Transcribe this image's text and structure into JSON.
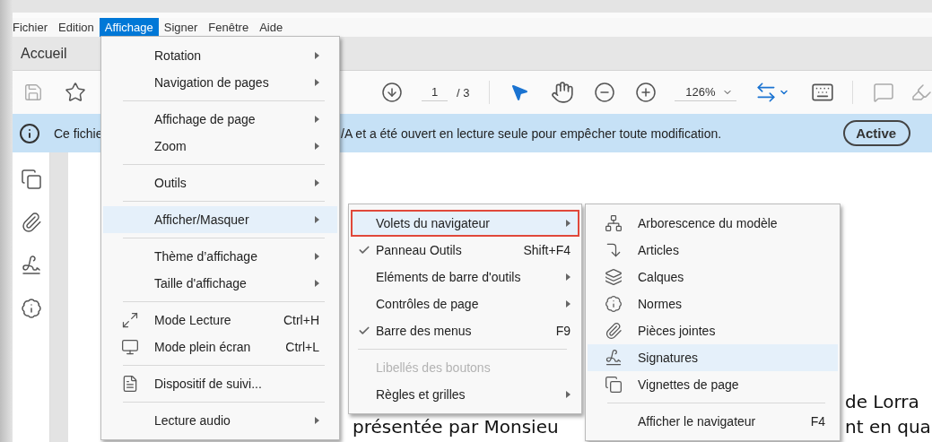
{
  "menubar": [
    {
      "label": "Fichier",
      "selected": false
    },
    {
      "label": "Edition",
      "selected": false
    },
    {
      "label": "Affichage",
      "selected": true
    },
    {
      "label": "Signer",
      "selected": false
    },
    {
      "label": "Fenêtre",
      "selected": false
    },
    {
      "label": "Aide",
      "selected": false
    }
  ],
  "tab": "Accueil",
  "toolbar": {
    "page_input": "1",
    "page_total": "/ 3",
    "zoom": "126%"
  },
  "banner": {
    "text_start": "Ce fichie",
    "text_end": "/A et a été ouvert en lecture seule pour empêcher toute modification.",
    "button": "Active"
  },
  "document": {
    "lines": [
      "de Lorra",
      "présentée par Monsieu",
      "nt en qua"
    ]
  },
  "menus": [
    {
      "items": [
        {
          "kind": "item",
          "label": "Rotation",
          "submenu": true,
          "selected": false
        },
        {
          "kind": "item",
          "label": "Navigation de pages",
          "submenu": true,
          "selected": false
        },
        {
          "kind": "separator"
        },
        {
          "kind": "item",
          "label": "Affichage de page",
          "submenu": true,
          "selected": false
        },
        {
          "kind": "item",
          "label": "Zoom",
          "submenu": true,
          "selected": false
        },
        {
          "kind": "separator"
        },
        {
          "kind": "item",
          "label": "Outils",
          "submenu": true,
          "selected": false
        },
        {
          "kind": "separator"
        },
        {
          "kind": "item",
          "label": "Afficher/Masquer",
          "submenu": true,
          "selected": true
        },
        {
          "kind": "separator"
        },
        {
          "kind": "item",
          "label": "Thème d’affichage",
          "submenu": true,
          "selected": false
        },
        {
          "kind": "item",
          "label": "Taille d'affichage",
          "submenu": true,
          "selected": false
        },
        {
          "kind": "separator"
        },
        {
          "kind": "icon",
          "label": "Mode Lecture",
          "shortcut": "Ctrl+H",
          "submenu": false,
          "selected": false
        },
        {
          "kind": "icon",
          "label": "Mode plein écran",
          "shortcut": "Ctrl+L",
          "submenu": false,
          "selected": false
        },
        {
          "kind": "separator"
        },
        {
          "kind": "icon",
          "label": "Dispositif de suivi...",
          "submenu": false,
          "selected": false
        },
        {
          "kind": "separator"
        },
        {
          "kind": "item",
          "label": "Lecture audio",
          "submenu": true,
          "selected": false
        }
      ]
    },
    {
      "items": [
        {
          "kind": "item",
          "label": "Volets du navigateur",
          "submenu": true,
          "selected": true,
          "outlined": true,
          "checked": false,
          "disabled": false
        },
        {
          "kind": "item",
          "label": "Panneau Outils",
          "shortcut": "Shift+F4",
          "submenu": false,
          "selected": false,
          "outlined": false,
          "checked": true,
          "disabled": false
        },
        {
          "kind": "item",
          "label": "Eléments de barre d'outils",
          "submenu": true,
          "selected": false,
          "outlined": false,
          "checked": false,
          "disabled": false
        },
        {
          "kind": "item",
          "label": "Contrôles de page",
          "submenu": true,
          "selected": false,
          "outlined": false,
          "checked": false,
          "disabled": false
        },
        {
          "kind": "item",
          "label": "Barre des menus",
          "shortcut": "F9",
          "submenu": false,
          "selected": false,
          "outlined": false,
          "checked": true,
          "disabled": false
        },
        {
          "kind": "separator"
        },
        {
          "kind": "item",
          "label": "Libellés des boutons",
          "submenu": false,
          "selected": false,
          "outlined": false,
          "checked": false,
          "disabled": true
        },
        {
          "kind": "item",
          "label": "Règles et grilles",
          "submenu": true,
          "selected": false,
          "outlined": false,
          "checked": false,
          "disabled": false
        }
      ]
    },
    {
      "items": [
        {
          "kind": "icon",
          "label": "Arborescence du modèle",
          "submenu": false,
          "selected": false
        },
        {
          "kind": "icon",
          "label": "Articles",
          "submenu": false,
          "selected": false
        },
        {
          "kind": "icon",
          "label": "Calques",
          "submenu": false,
          "selected": false
        },
        {
          "kind": "icon",
          "label": "Normes",
          "submenu": false,
          "selected": false
        },
        {
          "kind": "icon",
          "label": "Pièces jointes",
          "submenu": false,
          "selected": false
        },
        {
          "kind": "icon",
          "label": "Signatures",
          "submenu": false,
          "selected": true
        },
        {
          "kind": "icon",
          "label": "Vignettes de page",
          "submenu": false,
          "selected": false
        },
        {
          "kind": "separator"
        },
        {
          "kind": "item",
          "label": "Afficher le navigateur",
          "shortcut": "F4",
          "submenu": false,
          "selected": false
        }
      ]
    }
  ]
}
